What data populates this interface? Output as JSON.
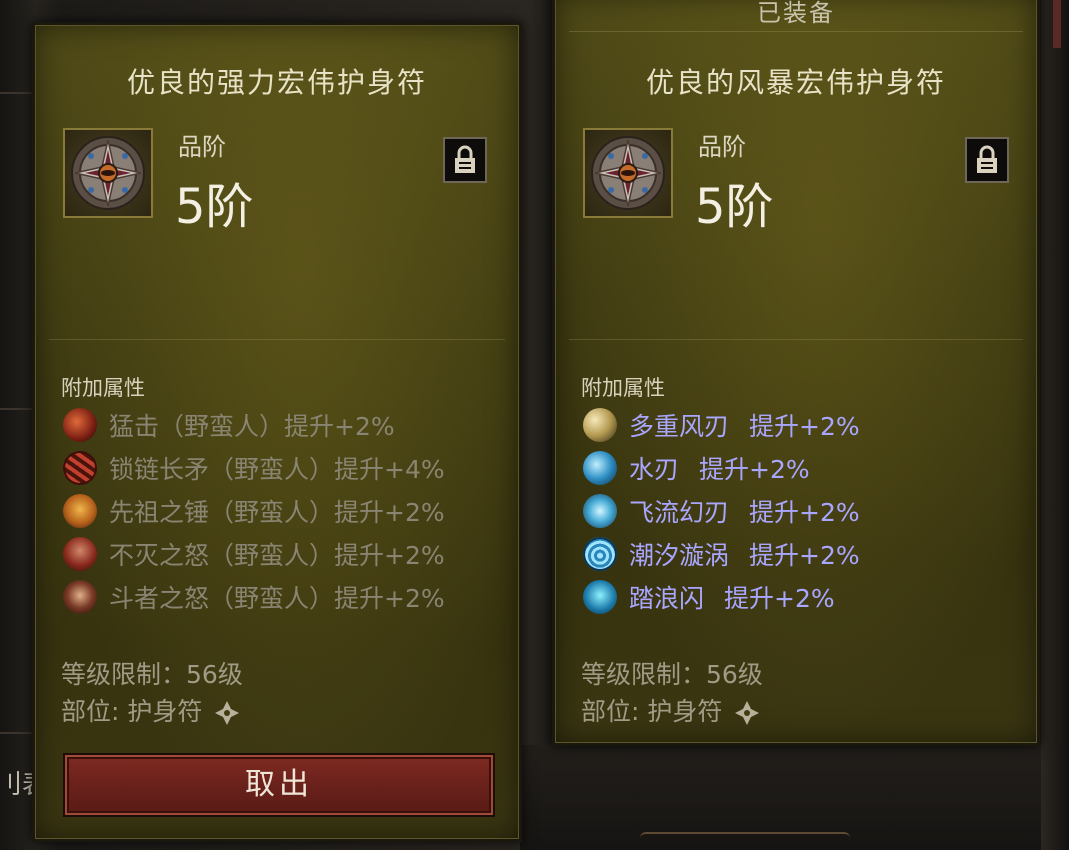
{
  "background": {
    "side_text": "刂表"
  },
  "left_item": {
    "title": "优良的强力宏伟护身符",
    "grade_label": "品阶",
    "grade_value": "5阶",
    "affix_header": "附加属性",
    "affixes": [
      {
        "skill": "猛击（野蛮人）",
        "bonus": "提升+2%",
        "icon": "bash-skill-icon",
        "state": "inactive"
      },
      {
        "skill": "锁链长矛（野蛮人）",
        "bonus": "提升+4%",
        "icon": "chain-spear-skill-icon",
        "state": "inactive"
      },
      {
        "skill": "先祖之锤（野蛮人）",
        "bonus": "提升+2%",
        "icon": "ancestral-hammer-skill-icon",
        "state": "inactive"
      },
      {
        "skill": "不灭之怒（野蛮人）",
        "bonus": "提升+2%",
        "icon": "undying-rage-skill-icon",
        "state": "inactive"
      },
      {
        "skill": "斗者之怒（野蛮人）",
        "bonus": "提升+2%",
        "icon": "battle-rage-skill-icon",
        "state": "inactive"
      }
    ],
    "level_requirement": "等级限制：56级",
    "slot": "部位: 护身符",
    "take_out_label": "取出"
  },
  "right_item": {
    "equipped_label": "已装备",
    "title": "优良的风暴宏伟护身符",
    "grade_label": "品阶",
    "grade_value": "5阶",
    "affix_header": "附加属性",
    "affixes": [
      {
        "skill": "多重风刃",
        "bonus": "提升+2%",
        "icon": "multi-wind-blade-skill-icon",
        "state": "active"
      },
      {
        "skill": "水刃",
        "bonus": "提升+2%",
        "icon": "water-blade-skill-icon",
        "state": "active"
      },
      {
        "skill": "飞流幻刃",
        "bonus": "提升+2%",
        "icon": "flying-phantom-blade-skill-icon",
        "state": "active"
      },
      {
        "skill": "潮汐漩涡",
        "bonus": "提升+2%",
        "icon": "tidal-vortex-skill-icon",
        "state": "active"
      },
      {
        "skill": "踏浪闪",
        "bonus": "提升+2%",
        "icon": "wave-step-skill-icon",
        "state": "active"
      }
    ],
    "level_requirement": "等级限制：56级",
    "slot": "部位: 护身符"
  },
  "colors": {
    "panel_bg": "#3f3b12",
    "inactive_affix": "#8a8472",
    "active_affix": "#a9a6ff",
    "button_red": "#7e2a22"
  }
}
